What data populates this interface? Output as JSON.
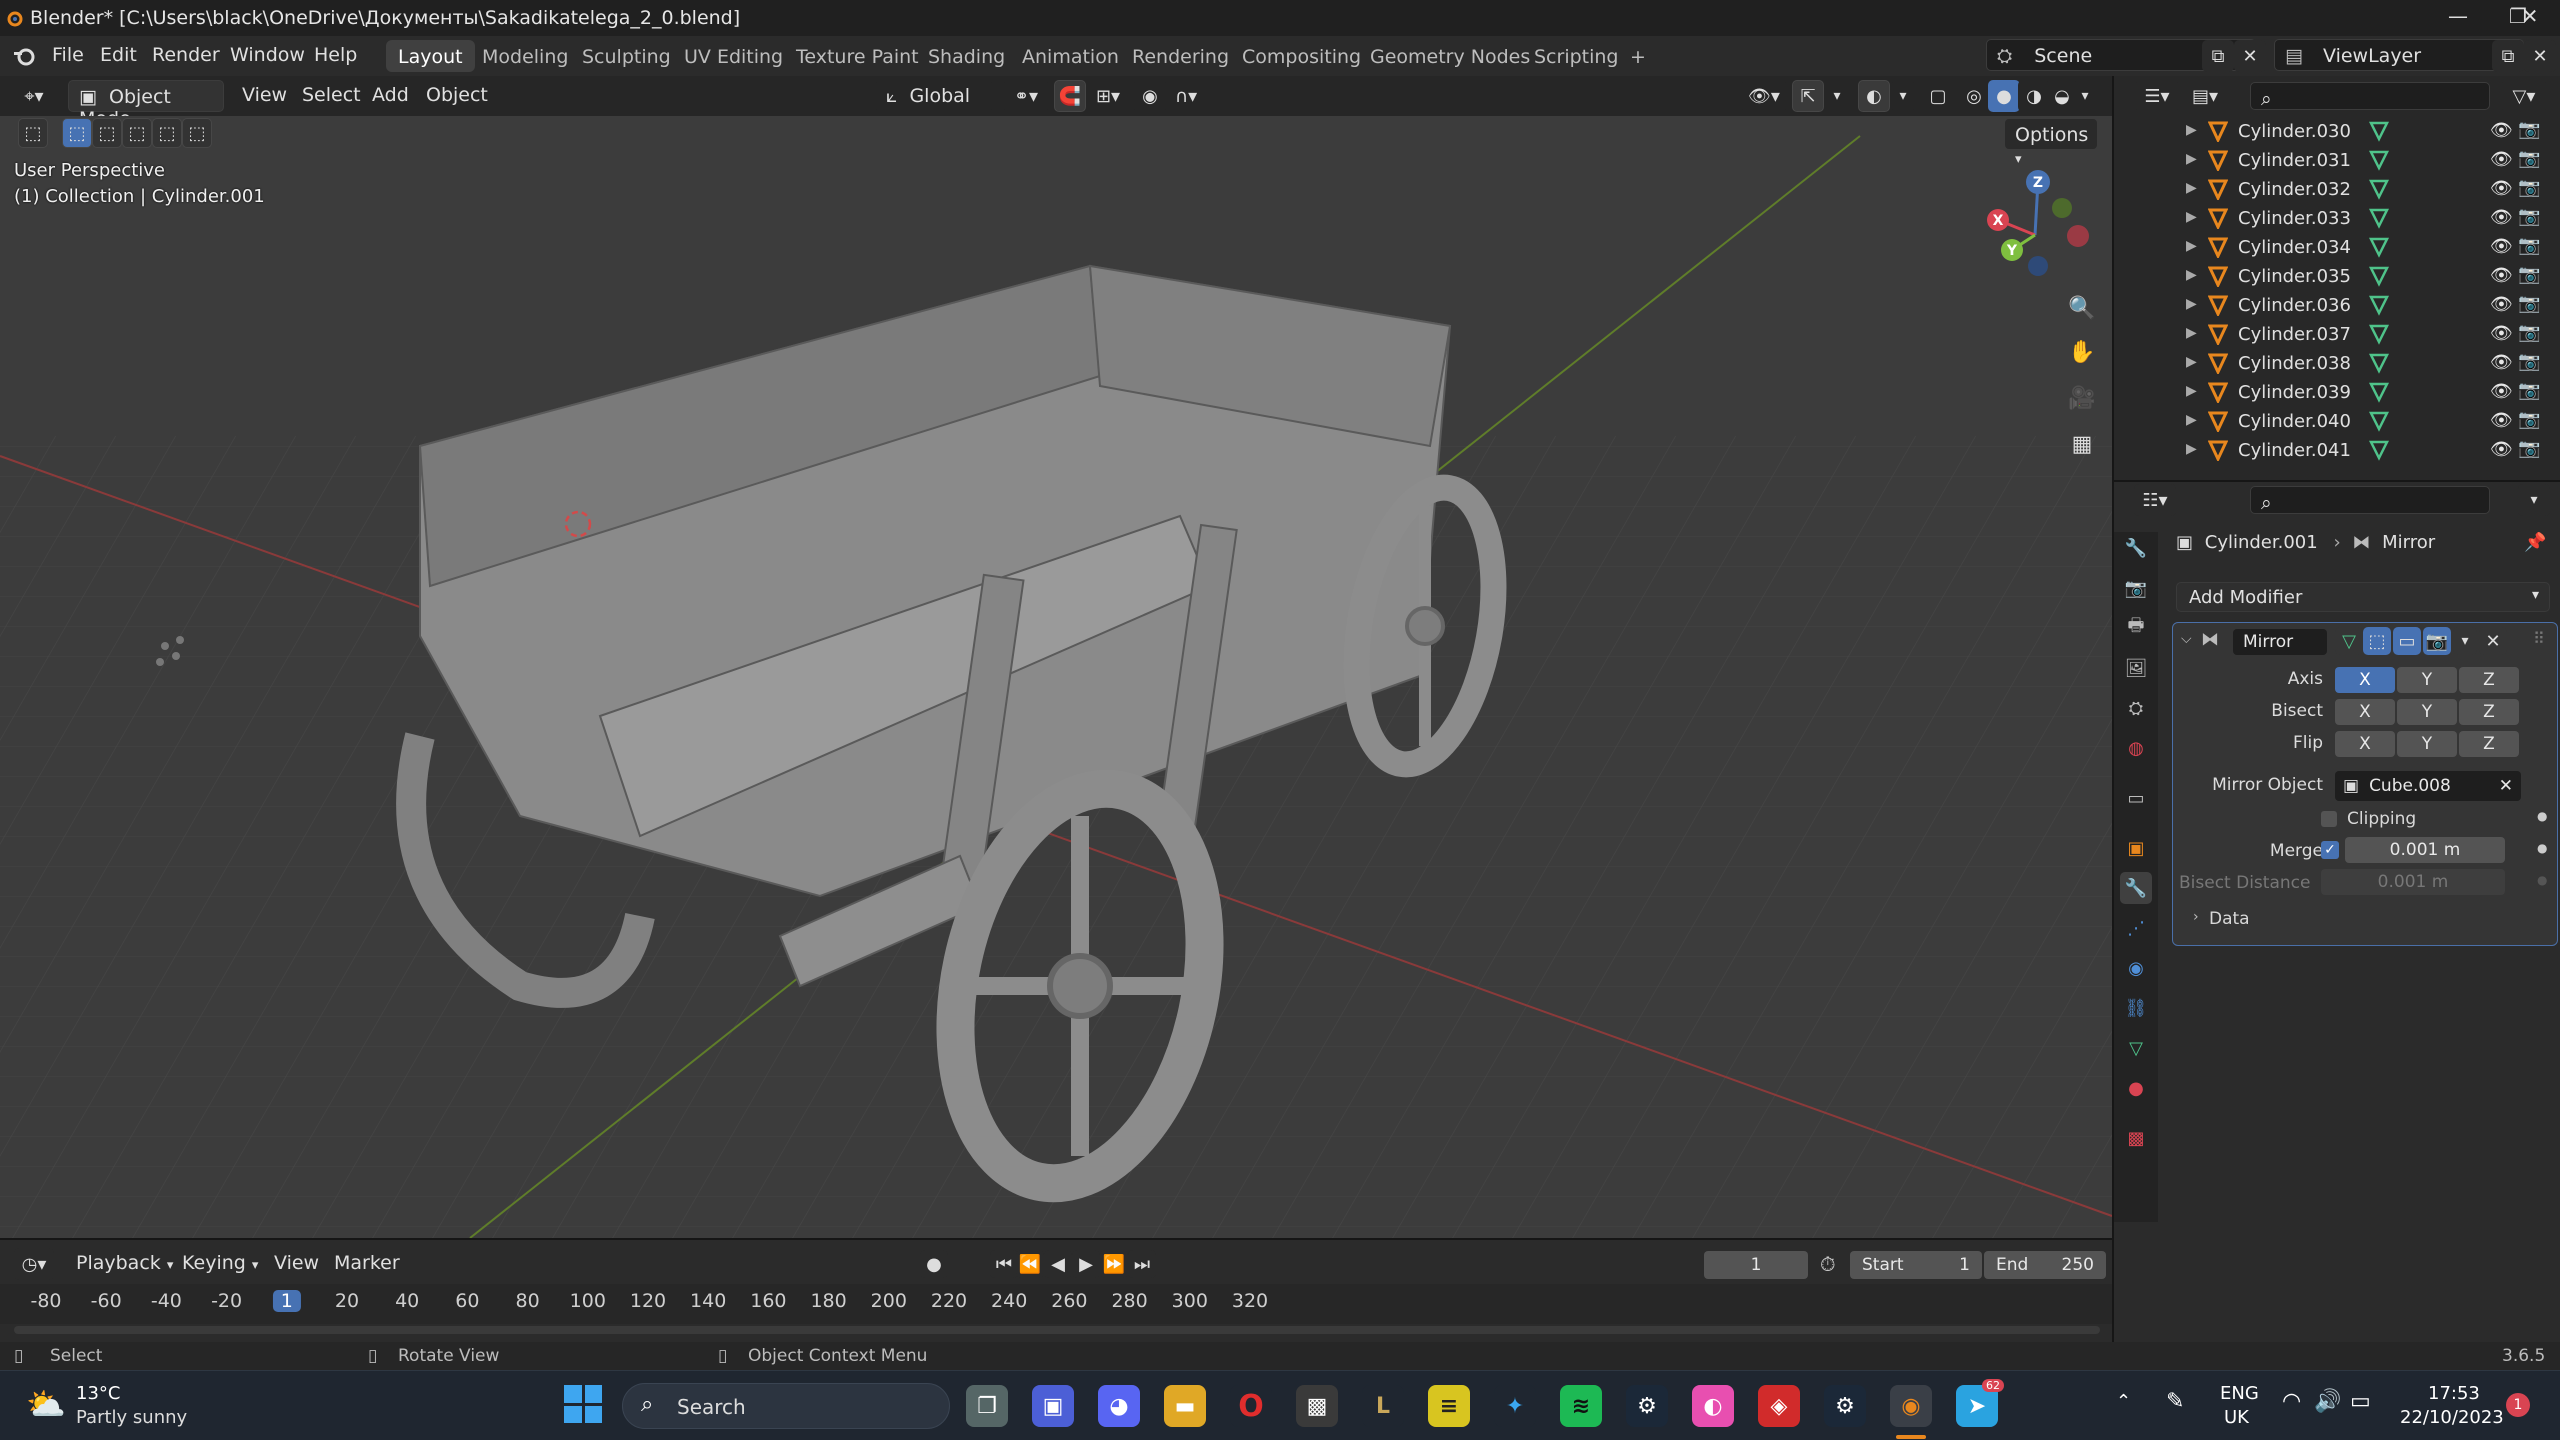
{
  "window": {
    "title": "Blender* [C:\\Users\\black\\OneDrive\\Документы\\Sakadikatelega_2_0.blend]",
    "minimize": "—",
    "maximize": "❐",
    "close": "✕"
  },
  "menu": [
    "File",
    "Edit",
    "Render",
    "Window",
    "Help"
  ],
  "workspaces": [
    "Layout",
    "Modeling",
    "Sculpting",
    "UV Editing",
    "Texture Paint",
    "Shading",
    "Animation",
    "Rendering",
    "Compositing",
    "Geometry Nodes",
    "Scripting"
  ],
  "workspace_add": "+",
  "scene": {
    "name": "Scene",
    "view_layer": "ViewLayer"
  },
  "viewport_header": {
    "mode": "Object Mode",
    "menus": [
      "View",
      "Select",
      "Add",
      "Object"
    ],
    "transform_orientation": "Global",
    "options": "Options"
  },
  "viewport": {
    "perspective": "User Perspective",
    "collection": "(1) Collection | Cylinder.001",
    "gizmo": {
      "x": "X",
      "y": "Y",
      "z": "Z"
    }
  },
  "outliner": {
    "rows": [
      "Cylinder.030",
      "Cylinder.031",
      "Cylinder.032",
      "Cylinder.033",
      "Cylinder.034",
      "Cylinder.035",
      "Cylinder.036",
      "Cylinder.037",
      "Cylinder.038",
      "Cylinder.039",
      "Cylinder.040",
      "Cylinder.041"
    ]
  },
  "properties": {
    "breadcrumb_object": "Cylinder.001",
    "breadcrumb_modifier": "Mirror",
    "add_modifier": "Add Modifier",
    "modifier_name": "Mirror",
    "axis_label": "Axis",
    "bisect_label": "Bisect",
    "flip_label": "Flip",
    "xyz": [
      "X",
      "Y",
      "Z"
    ],
    "axis_active": "X",
    "mirror_object_label": "Mirror Object",
    "mirror_object": "Cube.008",
    "clipping_label": "Clipping",
    "merge_label": "Merge",
    "merge_value": "0.001 m",
    "bisect_distance_label": "Bisect Distance",
    "bisect_distance_value": "0.001 m",
    "data_label": "Data"
  },
  "timeline": {
    "menus": [
      "Playback",
      "Keying",
      "View",
      "Marker"
    ],
    "current_frame": "1",
    "start_label": "Start",
    "start": "1",
    "end_label": "End",
    "end": "250",
    "ticks": [
      "-80",
      "-60",
      "-40",
      "-20",
      "1",
      "20",
      "40",
      "60",
      "80",
      "100",
      "120",
      "140",
      "160",
      "180",
      "200",
      "220",
      "240",
      "260",
      "280",
      "300",
      "320"
    ]
  },
  "statusbar": {
    "select": "Select",
    "rotate": "Rotate View",
    "context": "Object Context Menu",
    "version": "3.6.5"
  },
  "taskbar": {
    "weather_temp": "13°C",
    "weather_desc": "Partly sunny",
    "search": "Search",
    "language": "ENG",
    "region": "UK",
    "time": "17:53",
    "date": "22/10/2023",
    "notification_count": "1",
    "telegram_badge": "62"
  },
  "colors": {
    "accent_blue": "#4772b3",
    "active_orange": "#e8871e",
    "mesh_green": "#4fc38a",
    "axis_red": "#d94452",
    "axis_green": "#7fbf3f"
  }
}
